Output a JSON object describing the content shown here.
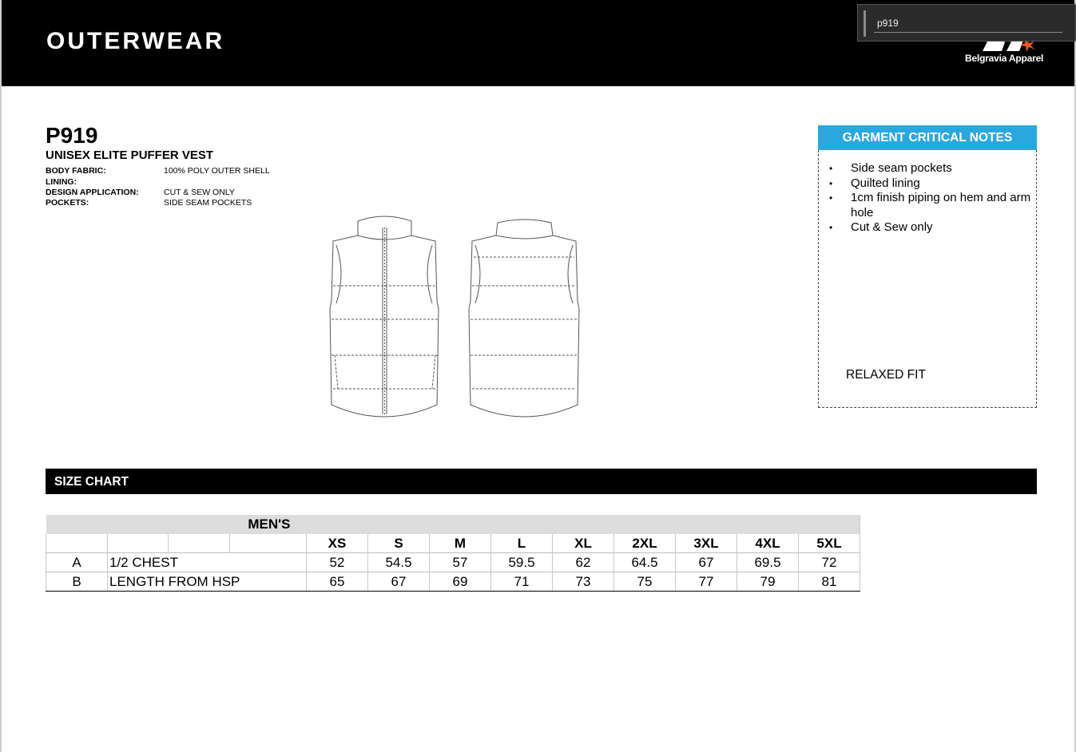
{
  "header": {
    "title": "OUTERWEAR",
    "brand_name": "Belgravia Apparel",
    "logo_icon": "belgravia-logo-icon"
  },
  "find_bar": {
    "value": "p919"
  },
  "product": {
    "code": "P919",
    "name": "UNISEX ELITE PUFFER VEST",
    "specs": [
      {
        "label": "BODY FABRIC:",
        "value": "100% POLY OUTER SHELL"
      },
      {
        "label": "LINING:",
        "value": ""
      },
      {
        "label": "DESIGN APPLICATION:",
        "value": "CUT & SEW ONLY"
      },
      {
        "label": "POCKETS:",
        "value": "SIDE SEAM POCKETS"
      }
    ]
  },
  "notes": {
    "title": "GARMENT CRITICAL NOTES",
    "bullet": "•",
    "items": [
      "Side seam pockets",
      "Quilted lining",
      "1cm finish piping on hem and arm hole",
      "Cut & Sew only"
    ],
    "fit": "RELAXED FIT"
  },
  "size_chart": {
    "title": "SIZE CHART",
    "group": "MEN'S",
    "sizes": [
      "XS",
      "S",
      "M",
      "L",
      "XL",
      "2XL",
      "3XL",
      "4XL",
      "5XL"
    ],
    "rows": [
      {
        "code": "A",
        "measure": "1/2 CHEST",
        "values": [
          "52",
          "54.5",
          "57",
          "59.5",
          "62",
          "64.5",
          "67",
          "69.5",
          "72"
        ]
      },
      {
        "code": "B",
        "measure": "LENGTH FROM HSP",
        "values": [
          "65",
          "67",
          "69",
          "71",
          "73",
          "75",
          "77",
          "79",
          "81"
        ]
      }
    ]
  },
  "colors": {
    "header_bg": "#000000",
    "notes_accent": "#29a8df",
    "logo_accent": "#e8571e"
  }
}
